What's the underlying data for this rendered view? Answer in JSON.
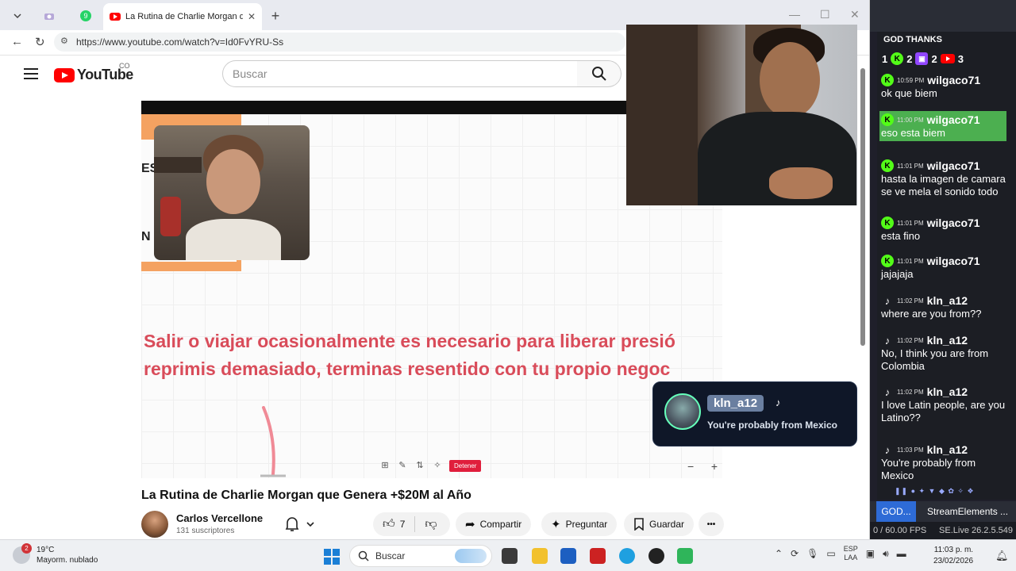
{
  "browser": {
    "tab_title": "La Rutina de Charlie Morgan que (",
    "pinned_badge": "9",
    "url": "https://www.youtube.com/watch?v=Id0FvYRU-Ss"
  },
  "youtube": {
    "logo_text": "YouTube",
    "country": "CO",
    "search_placeholder": "Buscar"
  },
  "video": {
    "subtitle_line1": "Salir o viajar ocasionalmente es necesario para liberar presió",
    "subtitle_line2": "reprimis demasiado, terminas resentido con tu propio negoc",
    "frame_letters_1": "ES",
    "frame_letters_2": "N C",
    "stop_label": "Detener",
    "zoom_minus": "−",
    "zoom_plus": "+",
    "title": "La Rutina de Charlie Morgan que Genera +$20M al Año",
    "channel": "Carlos Vercellone",
    "subscribers": "131 suscriptores",
    "likes": "7",
    "share_label": "Compartir",
    "ask_label": "Preguntar",
    "save_label": "Guardar",
    "more_label": "•••"
  },
  "notification": {
    "user": "kln_a12",
    "message": "You're probably from Mexico"
  },
  "chat": {
    "header": "GOD THANKS",
    "counts": {
      "kick": "1",
      "kick2": "2",
      "twitch": "2",
      "youtube": "3"
    },
    "messages": [
      {
        "platform": "kick",
        "time": "10:59 PM",
        "user": "wilgaco71",
        "text": "ok que biem"
      },
      {
        "platform": "kick",
        "time": "11:00 PM",
        "user": "wilgaco71",
        "text": "eso esta biem",
        "highlight": true
      },
      {
        "platform": "kick",
        "time": "11:01 PM",
        "user": "wilgaco71",
        "text": "hasta la imagen de camara se ve mela el sonido todo"
      },
      {
        "platform": "kick",
        "time": "11:01 PM",
        "user": "wilgaco71",
        "text": "esta fino"
      },
      {
        "platform": "kick",
        "time": "11:01 PM",
        "user": "wilgaco71",
        "text": "jajajaja"
      },
      {
        "platform": "tiktok",
        "time": "11:02 PM",
        "user": "kln_a12",
        "text": "where are you from??"
      },
      {
        "platform": "tiktok",
        "time": "11:02 PM",
        "user": "kln_a12",
        "text": "No, I think you are from Colombia"
      },
      {
        "platform": "tiktok",
        "time": "11:02 PM",
        "user": "kln_a12",
        "text": "I love Latin people, are you Latino??"
      },
      {
        "platform": "tiktok",
        "time": "11:03 PM",
        "user": "kln_a12",
        "text": "You're probably from Mexico"
      }
    ]
  },
  "obs": {
    "tab_god": "GOD...",
    "tab_se": "StreamElements ...",
    "fps": "0 / 60.00 FPS",
    "version": "SE.Live 26.2.5.549"
  },
  "taskbar": {
    "weather_badge": "2",
    "temp": "19°C",
    "weather_desc": "Mayorm. nublado",
    "search": "Buscar",
    "lang1": "ESP",
    "lang2": "LAA",
    "time": "11:03 p. m.",
    "date": "23/02/2026"
  }
}
